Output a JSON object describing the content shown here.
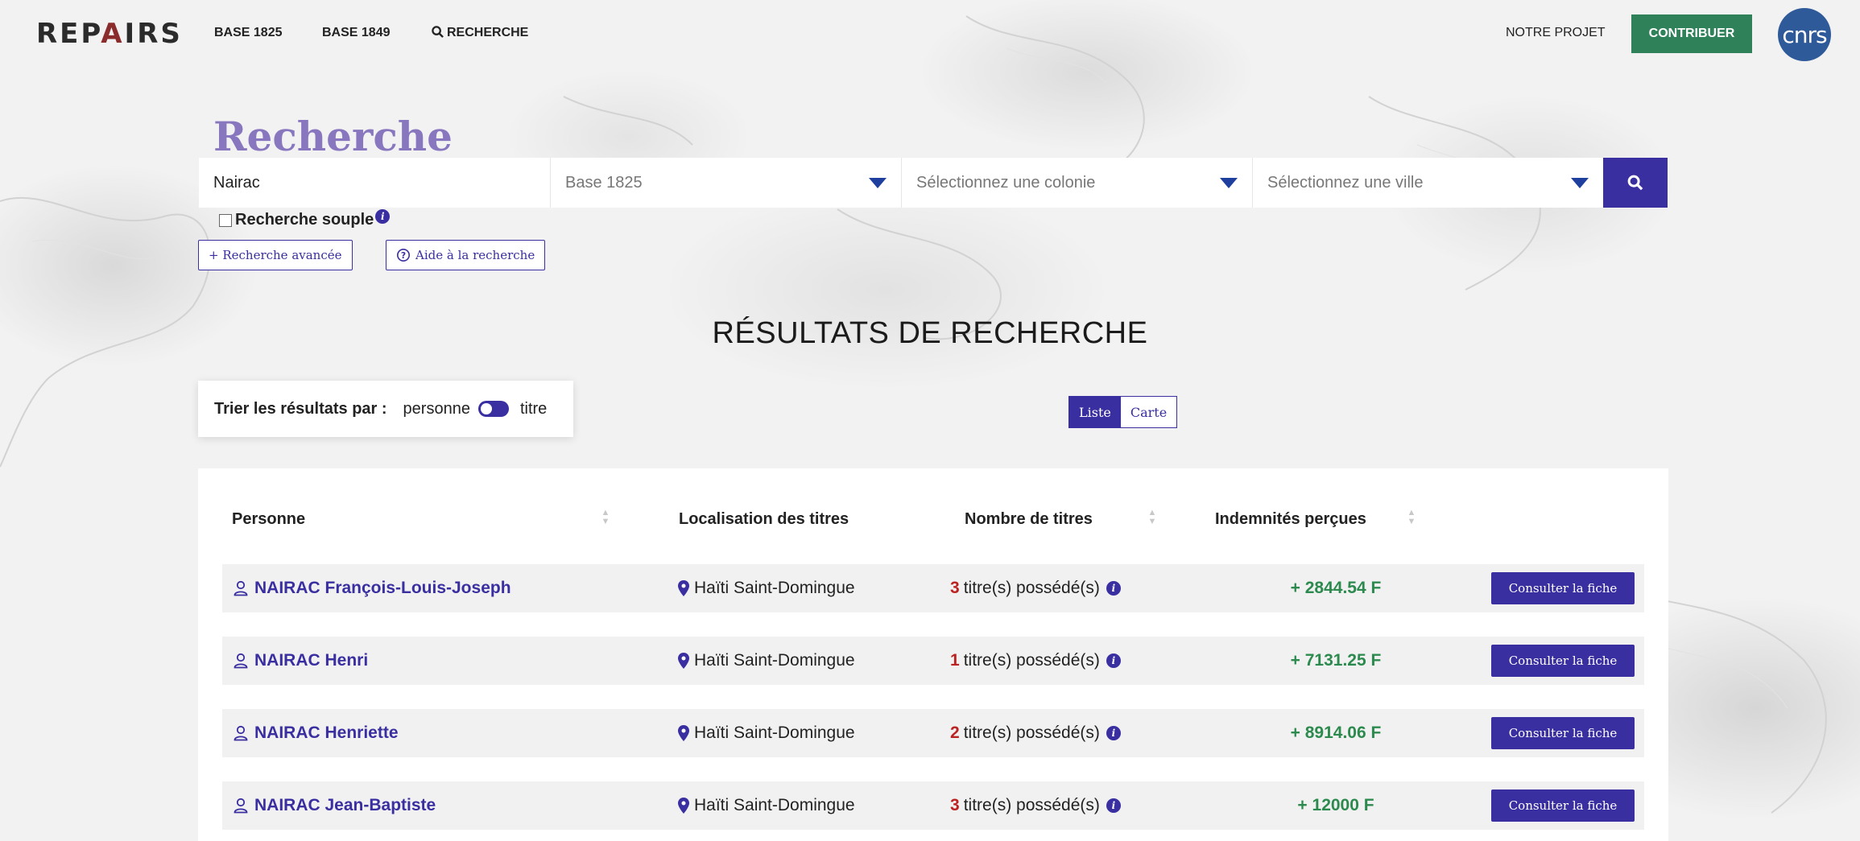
{
  "header": {
    "logo": "REPAIRS",
    "nav": {
      "base1825": "BASE 1825",
      "base1849": "BASE 1849",
      "recherche": "RECHERCHE",
      "notre_projet": "NOTRE PROJET",
      "contribuer": "CONTRIBUER"
    },
    "partner_logo": "cnrs"
  },
  "search": {
    "title": "Recherche",
    "query": "Nairac",
    "base_select": "Base 1825",
    "colony_placeholder": "Sélectionnez une colonie",
    "city_placeholder": "Sélectionnez une ville",
    "soft_search_label": "Recherche souple",
    "advanced_label": "+ Recherche avancée",
    "help_label": "Aide à la recherche"
  },
  "results": {
    "title": "RÉSULTATS DE RECHERCHE",
    "sort_label": "Trier les résultats par :",
    "sort_option_a": "personne",
    "sort_option_b": "titre",
    "view_liste": "Liste",
    "view_carte": "Carte",
    "columns": {
      "personne": "Personne",
      "localisation": "Localisation des titres",
      "nombre": "Nombre de titres",
      "indemnites": "Indemnités perçues"
    },
    "rows": [
      {
        "name": "NAIRAC François-Louis-Joseph",
        "location": "Haïti Saint-Domingue",
        "count": "3",
        "count_suffix": "titre(s) possédé(s)",
        "indemnity": "+ 2844.54 F",
        "action": "Consulter la fiche"
      },
      {
        "name": "NAIRAC Henri",
        "location": "Haïti Saint-Domingue",
        "count": "1",
        "count_suffix": "titre(s) possédé(s)",
        "indemnity": "+ 7131.25 F",
        "action": "Consulter la fiche"
      },
      {
        "name": "NAIRAC Henriette",
        "location": "Haïti Saint-Domingue",
        "count": "2",
        "count_suffix": "titre(s) possédé(s)",
        "indemnity": "+ 8914.06 F",
        "action": "Consulter la fiche"
      },
      {
        "name": "NAIRAC Jean-Baptiste",
        "location": "Haïti Saint-Domingue",
        "count": "3",
        "count_suffix": "titre(s) possédé(s)",
        "indemnity": "+ 12000 F",
        "action": "Consulter la fiche"
      }
    ]
  },
  "colors": {
    "accent": "#3a2fa0",
    "title_purple": "#8877bf",
    "contribute_green": "#2f8159",
    "indemnity_green": "#2d8a4e",
    "count_red": "#b22222"
  }
}
